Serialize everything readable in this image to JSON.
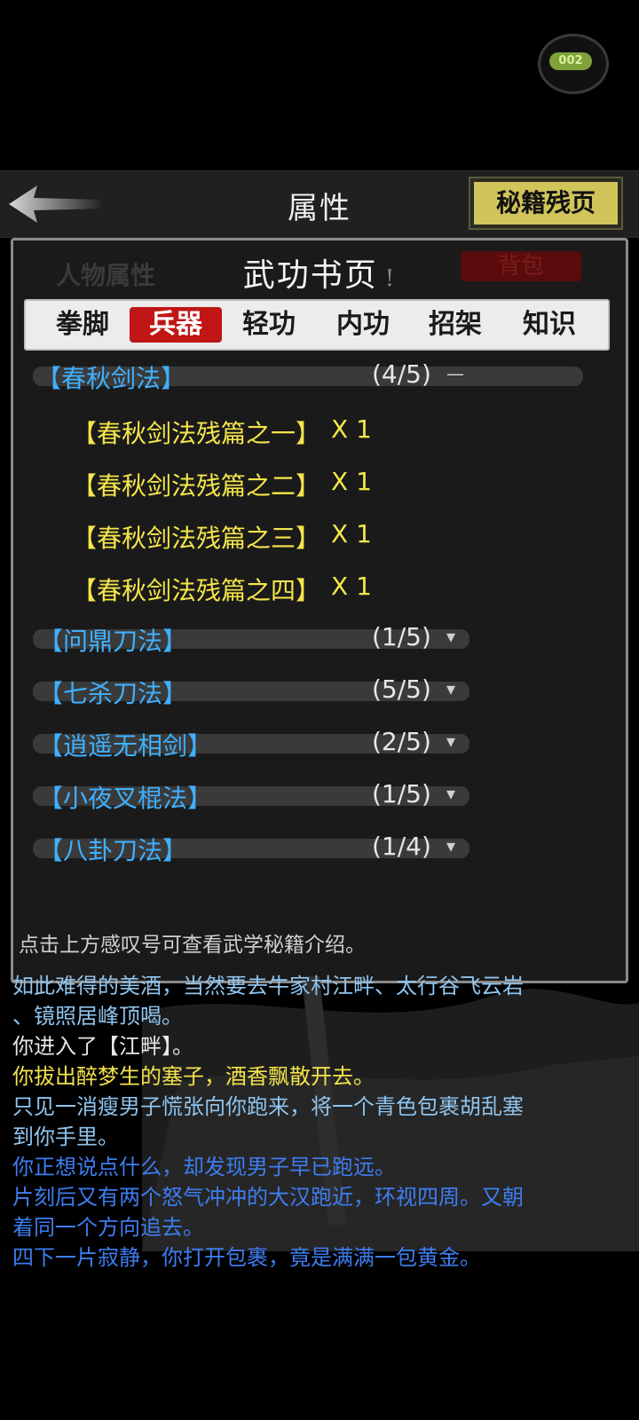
{
  "top_badge": {
    "text": "002"
  },
  "header": {
    "title": "属性",
    "secret_button": "秘籍残页"
  },
  "panel": {
    "ghost_tabs": {
      "left": "人物属性",
      "right": "背包"
    },
    "heading": "武功书页",
    "heading_excl": "!",
    "tabs": [
      "拳脚",
      "兵器",
      "轻功",
      "内功",
      "招架",
      "知识"
    ],
    "active_tab": "兵器",
    "categories": [
      {
        "name": "【春秋剑法】",
        "count": "(4/5)",
        "toggle": "—",
        "pages": [
          {
            "name": "【春秋剑法残篇之一】",
            "qty": "X 1"
          },
          {
            "name": "【春秋剑法残篇之二】",
            "qty": "X 1"
          },
          {
            "name": "【春秋剑法残篇之三】",
            "qty": "X 1"
          },
          {
            "name": "【春秋剑法残篇之四】",
            "qty": "X 1"
          }
        ]
      },
      {
        "name": "【问鼎刀法】",
        "count": "(1/5)",
        "toggle": "▾"
      },
      {
        "name": "【七杀刀法】",
        "count": "(5/5)",
        "toggle": "▾"
      },
      {
        "name": "【逍遥无相剑】",
        "count": "(2/5)",
        "toggle": "▾"
      },
      {
        "name": "【小夜叉棍法】",
        "count": "(1/5)",
        "toggle": "▾"
      },
      {
        "name": "【八卦刀法】",
        "count": "(1/4)",
        "toggle": "▾"
      }
    ],
    "hint": "点击上方感叹号可查看武学秘籍介绍。"
  },
  "log": [
    {
      "text": "如此难得的美酒，当然要去牛家村江畔、太行谷飞云岩",
      "color": "lblue"
    },
    {
      "text": "、镜照居峰顶喝。",
      "color": "lblue"
    },
    {
      "text": "你进入了【江畔】。",
      "color": "white"
    },
    {
      "text": "你拔出醉梦生的塞子，酒香飘散开去。",
      "color": "yellow"
    },
    {
      "text": "只见一消瘦男子慌张向你跑来，将一个青色包裹胡乱塞",
      "color": "lblue"
    },
    {
      "text": "到你手里。",
      "color": "lblue"
    },
    {
      "text": "你正想说点什么，却发现男子早已跑远。",
      "color": "blue"
    },
    {
      "text": "片刻后又有两个怒气冲冲的大汉跑近，环视四周。又朝",
      "color": "blue"
    },
    {
      "text": "着同一个方向追去。",
      "color": "blue"
    },
    {
      "text": "四下一片寂静，你打开包裹，竟是满满一包黄金。",
      "color": "blue"
    }
  ]
}
